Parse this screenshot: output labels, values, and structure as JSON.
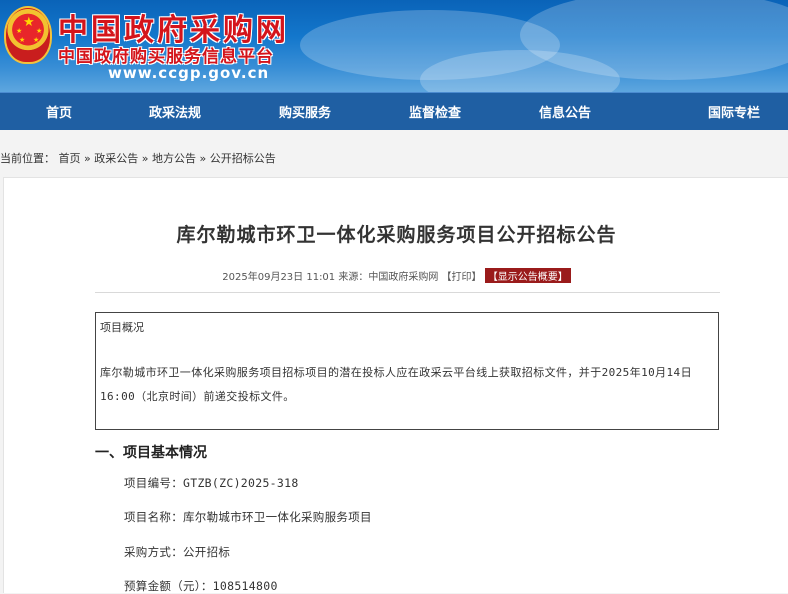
{
  "header": {
    "title": "中国政府采购网",
    "subtitle": "中国政府购买服务信息平台",
    "url": "www.ccgp.gov.cn",
    "emblem_icon": "national-emblem-icon"
  },
  "nav": {
    "items": [
      "首页",
      "政采法规",
      "购买服务",
      "监督检查",
      "信息公告",
      "国际专栏"
    ]
  },
  "breadcrumb": {
    "prefix": "当前位置：",
    "items": [
      "首页",
      "政采公告",
      "地方公告",
      "公开招标公告"
    ],
    "separator": "»"
  },
  "article": {
    "title": "库尔勒城市环卫一体化采购服务项目公开招标公告",
    "date": "2025年09月23日 11:01",
    "source_label": "来源：",
    "source": "中国政府采购网",
    "print_label": "【打印】",
    "show_list_label": "【显示公告概要】",
    "summary": {
      "heading": "项目概况",
      "body": "库尔勒城市环卫一体化采购服务项目招标项目的潜在投标人应在政采云平台线上获取招标文件，并于2025年10月14日 16:00（北京时间）前递交投标文件。"
    },
    "section1": {
      "heading": "一、项目基本情况",
      "fields": [
        "项目编号：GTZB(ZC)2025-318",
        "项目名称：库尔勒城市环卫一体化采购服务项目",
        "采购方式：公开招标",
        "预算金额（元）：108514800"
      ]
    }
  },
  "colors": {
    "banner_blue": "#0a63b8",
    "nav_blue": "#1f5fa3",
    "title_red": "#d4141b",
    "badge_red": "#9a1b1b"
  }
}
